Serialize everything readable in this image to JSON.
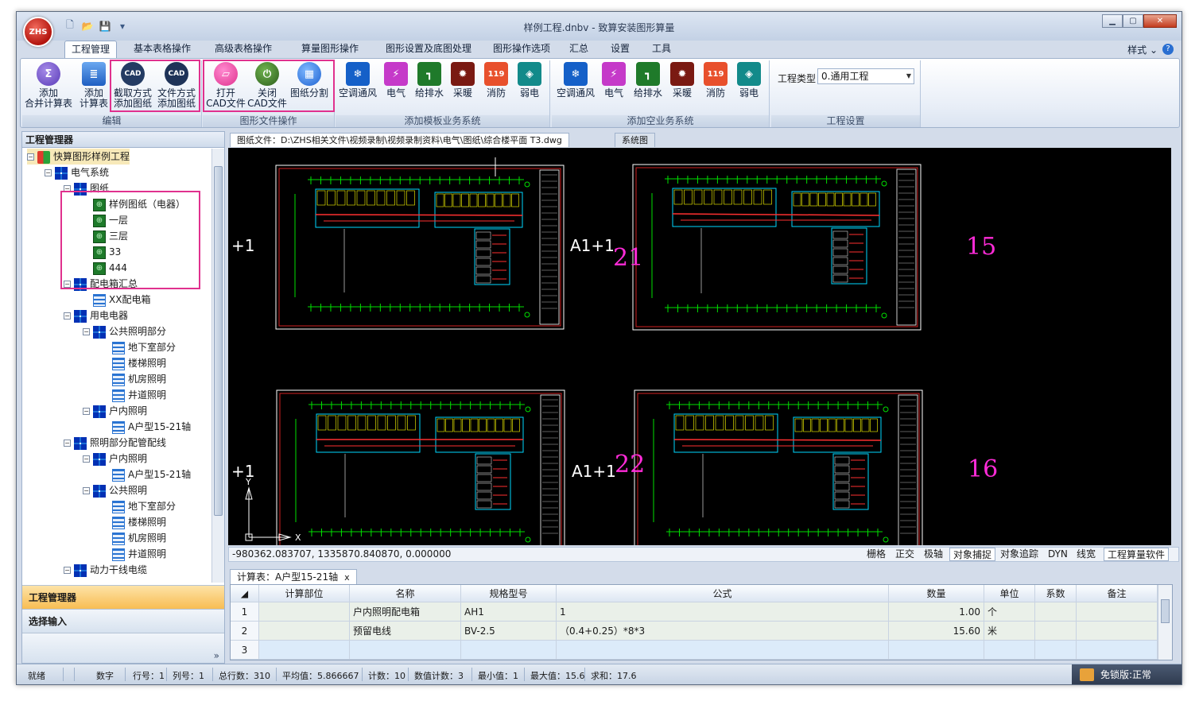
{
  "window": {
    "title": "样例工程.dnbv - 致算安装图形算量",
    "logo_text": "ZHS"
  },
  "menu": {
    "tabs": [
      "工程管理",
      "基本表格操作",
      "高级表格操作",
      "算量图形操作",
      "图形设置及底图处理",
      "图形操作选项",
      "汇总",
      "设置",
      "工具"
    ],
    "active": "工程管理",
    "style_label": "样式",
    "style_arrow": "⌄"
  },
  "ribbon": {
    "edit_group": {
      "label": "编辑",
      "buttons": [
        {
          "l1": "添加",
          "l2": "合并计算表"
        },
        {
          "l1": "添加",
          "l2": "计算表"
        },
        {
          "l1": "截取方式",
          "l2": "添加图纸"
        },
        {
          "l1": "文件方式",
          "l2": "添加图纸"
        }
      ]
    },
    "file_group": {
      "label": "图形文件操作",
      "buttons": [
        {
          "l1": "打开",
          "l2": "CAD文件"
        },
        {
          "l1": "关闭",
          "l2": "CAD文件"
        },
        {
          "l1": "图纸分割",
          "l2": ""
        }
      ]
    },
    "template_group": {
      "label": "添加模板业务系统",
      "buttons": [
        "空调通风",
        "电气",
        "给排水",
        "采暖",
        "消防",
        "弱电"
      ]
    },
    "empty_group": {
      "label": "添加空业务系统",
      "buttons": [
        "空调通风",
        "电气",
        "给排水",
        "采暖",
        "消防",
        "弱电"
      ]
    },
    "settings_group": {
      "label": "工程设置",
      "type_label": "工程类型",
      "type_value": "0.通用工程"
    },
    "icon_text": {
      "cad": "CAD",
      "fire": "119",
      "sigma": "Σ"
    }
  },
  "left_panel": {
    "title": "工程管理器",
    "tree": [
      {
        "label": "快算图形样例工程",
        "level": 0,
        "icon": "root",
        "exp": "−"
      },
      {
        "label": "电气系统",
        "level": 1,
        "icon": "folder",
        "exp": "−"
      },
      {
        "label": "图纸",
        "level": 2,
        "icon": "folder",
        "exp": "−"
      },
      {
        "label": "样例图纸（电器）",
        "level": 3,
        "icon": "drawing"
      },
      {
        "label": "一层",
        "level": 3,
        "icon": "drawing"
      },
      {
        "label": "三层",
        "level": 3,
        "icon": "drawing"
      },
      {
        "label": "33",
        "level": 3,
        "icon": "drawing"
      },
      {
        "label": "444",
        "level": 3,
        "icon": "drawing"
      },
      {
        "label": "配电箱汇总",
        "level": 2,
        "icon": "folder",
        "exp": "−"
      },
      {
        "label": "XX配电箱",
        "level": 3,
        "icon": "sheet"
      },
      {
        "label": "用电电器",
        "level": 2,
        "icon": "folder",
        "exp": "−"
      },
      {
        "label": "公共照明部分",
        "level": 3,
        "icon": "folder",
        "exp": "−"
      },
      {
        "label": "地下室部分",
        "level": 4,
        "icon": "sheet"
      },
      {
        "label": "楼梯照明",
        "level": 4,
        "icon": "sheet"
      },
      {
        "label": "机房照明",
        "level": 4,
        "icon": "sheet"
      },
      {
        "label": "井道照明",
        "level": 4,
        "icon": "sheet"
      },
      {
        "label": "户内照明",
        "level": 3,
        "icon": "folder",
        "exp": "−"
      },
      {
        "label": "A户型15-21轴",
        "level": 4,
        "icon": "sheet"
      },
      {
        "label": "照明部分配管配线",
        "level": 2,
        "icon": "folder",
        "exp": "−"
      },
      {
        "label": "户内照明",
        "level": 3,
        "icon": "folder",
        "exp": "−"
      },
      {
        "label": "A户型15-21轴",
        "level": 4,
        "icon": "sheet"
      },
      {
        "label": "公共照明",
        "level": 3,
        "icon": "folder",
        "exp": "−"
      },
      {
        "label": "地下室部分",
        "level": 4,
        "icon": "sheet"
      },
      {
        "label": "楼梯照明",
        "level": 4,
        "icon": "sheet"
      },
      {
        "label": "机房照明",
        "level": 4,
        "icon": "sheet"
      },
      {
        "label": "井道照明",
        "level": 4,
        "icon": "sheet"
      },
      {
        "label": "动力干线电缆",
        "level": 2,
        "icon": "folder",
        "exp": "−"
      }
    ],
    "nav": [
      "工程管理器",
      "选择输入"
    ],
    "chevron": "»"
  },
  "cad": {
    "file_tab": "图纸文件：D:\\ZHS相关文件\\视频录制\\视频录制资料\\电气\\图纸\\综合楼平面 T3.dwg",
    "system_tab": "系统图",
    "labels": {
      "plus1_top": "+1",
      "a1p1_top": "A1+1",
      "n21": "21",
      "n15": "15",
      "plus1_bottom": "+1",
      "a1p1_bottom": "A1+1",
      "n22": "22",
      "n16": "16",
      "axis_x": "X",
      "axis_y": "Y"
    },
    "colors": {
      "magenta": "#ff2bd8",
      "green": "#00e000",
      "white": "#ffffff"
    },
    "coords": "-980362.083707,  1335870.840870,  0.000000",
    "modes": [
      "栅格",
      "正交",
      "极轴",
      "对象捕捉",
      "对象追踪",
      "DYN",
      "线宽",
      "工程算量软件"
    ],
    "modes_on": [
      "对象捕捉",
      "工程算量软件"
    ]
  },
  "calc": {
    "tab_label": "计算表：A户型15-21轴",
    "close": "x",
    "columns": [
      "计算部位",
      "名称",
      "规格型号",
      "公式",
      "数量",
      "单位",
      "系数",
      "备注"
    ],
    "rows": [
      {
        "no": "1",
        "part": "",
        "name": "户内照明配电箱",
        "spec": "AH1",
        "formula": "1",
        "qty": "1.00",
        "unit": "个",
        "coef": "",
        "note": ""
      },
      {
        "no": "2",
        "part": "",
        "name": "预留电线",
        "spec": "BV-2.5",
        "formula": "（0.4+0.25）*8*3",
        "qty": "15.60",
        "unit": "米",
        "coef": "",
        "note": ""
      },
      {
        "no": "3",
        "part": "",
        "name": "",
        "spec": "",
        "formula": "",
        "qty": "",
        "unit": "",
        "coef": "",
        "note": ""
      }
    ]
  },
  "status": {
    "ready": "就绪",
    "num": "数字",
    "row": "行号：1",
    "col": "列号：1",
    "total": "总行数：310",
    "avg": "平均值：5.866667",
    "count": "计数：10",
    "numcount": "数值计数：3",
    "min": "最小值：1",
    "max": "最大值：15.6",
    "sum": "求和：17.6",
    "free": "免锁版:正常"
  }
}
